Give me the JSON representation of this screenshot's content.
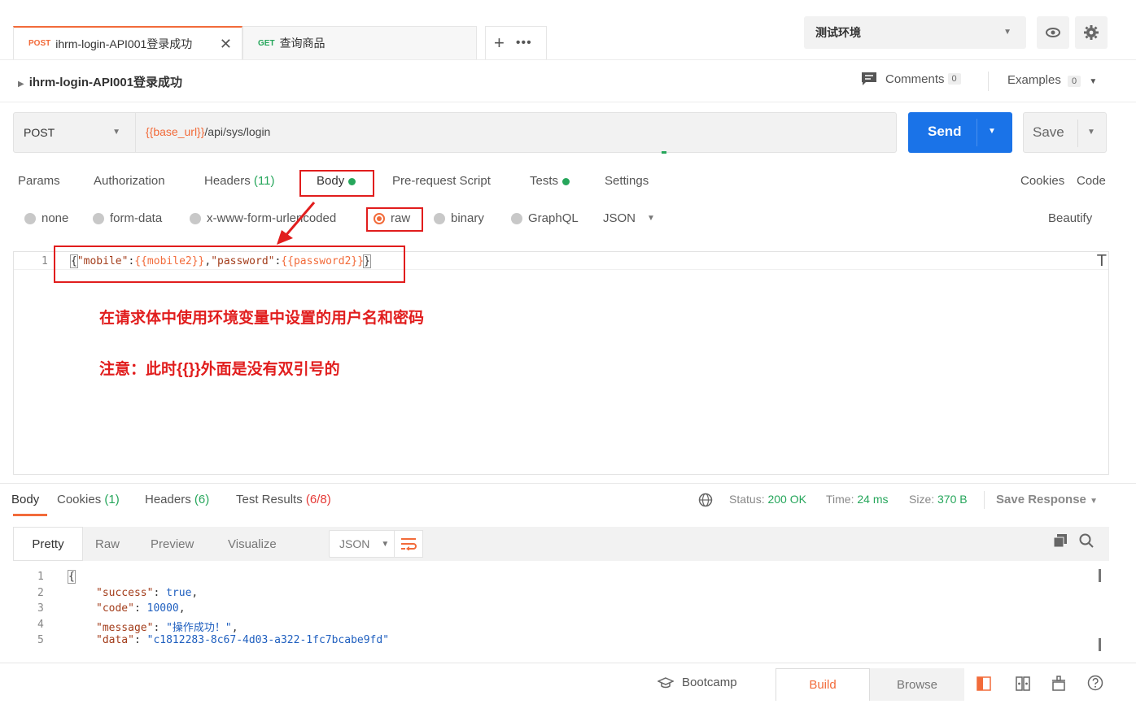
{
  "tabs": [
    {
      "method": "POST",
      "label": "ihrm-login-API001登录成功",
      "active": true
    },
    {
      "method": "GET",
      "label": "查询商品",
      "active": false
    }
  ],
  "tab_close": "✕",
  "tab_add": "+",
  "tab_more": "•••",
  "environment": {
    "selected": "测试环境"
  },
  "request": {
    "title": "ihrm-login-API001登录成功",
    "comments_label": "Comments",
    "comments_count": "0",
    "examples_label": "Examples",
    "examples_count": "0",
    "method": "POST",
    "url_var": "{{base_url}}",
    "url_path": "/api/sys/login",
    "send_label": "Send",
    "save_label": "Save"
  },
  "req_tabs": {
    "params": "Params",
    "authorization": "Authorization",
    "headers": "Headers",
    "headers_count": "(11)",
    "body": "Body",
    "prerequest": "Pre-request Script",
    "tests": "Tests",
    "settings": "Settings",
    "cookies": "Cookies",
    "code": "Code"
  },
  "body_types": {
    "none": "none",
    "form_data": "form-data",
    "urlencoded": "x-www-form-urlencoded",
    "raw": "raw",
    "binary": "binary",
    "graphql": "GraphQL",
    "format": "JSON",
    "beautify": "Beautify"
  },
  "editor": {
    "line_no": "1",
    "open": "{",
    "k1": "\"mobile\"",
    "c1": ":",
    "v1": "{{mobile2}}",
    "comma": ",",
    "k2": "\"password\"",
    "c2": ":",
    "v2": "{{password2}}",
    "close": "}"
  },
  "annotations": {
    "line1": "在请求体中使用环境变量中设置的用户名和密码",
    "line2": "注意：此时{{}}外面是没有双引号的"
  },
  "response": {
    "tabs": {
      "body": "Body",
      "cookies": "Cookies",
      "cookies_count": "(1)",
      "headers": "Headers",
      "headers_count": "(6)",
      "tests": "Test Results",
      "tests_count": "(6/8)"
    },
    "status_label": "Status:",
    "status_value": "200 OK",
    "time_label": "Time:",
    "time_value": "24 ms",
    "size_label": "Size:",
    "size_value": "370 B",
    "save_response": "Save Response",
    "views": {
      "pretty": "Pretty",
      "raw": "Raw",
      "preview": "Preview",
      "visualize": "Visualize"
    },
    "format": "JSON",
    "lines": [
      {
        "n": "1",
        "text": "{"
      },
      {
        "n": "2",
        "key": "\"success\"",
        "val": "true"
      },
      {
        "n": "3",
        "key": "\"code\"",
        "val": "10000"
      },
      {
        "n": "4",
        "key": "\"message\"",
        "val": "\"操作成功！\""
      },
      {
        "n": "5",
        "key": "\"data\"",
        "val": "\"c1812283-8c67-4d03-a322-1fc7bcabe9fd\""
      }
    ]
  },
  "statusbar": {
    "bootcamp": "Bootcamp",
    "build": "Build",
    "browse": "Browse"
  },
  "colors": {
    "accent": "#f26b3a",
    "send": "#1a73e8",
    "green": "#26a65b",
    "annotation": "#e11d1d"
  }
}
